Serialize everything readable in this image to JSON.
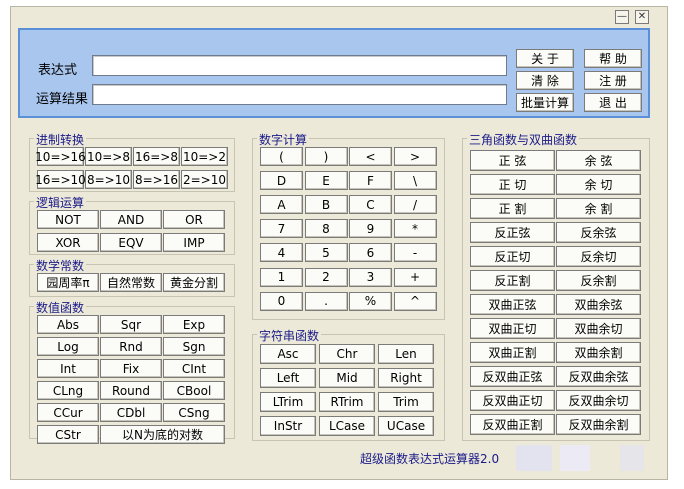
{
  "window": {
    "minimize_glyph": "—",
    "close_glyph": "✕"
  },
  "top": {
    "expression_label": "表达式",
    "result_label": "运算结果",
    "expression_value": "",
    "result_value": "",
    "buttons": [
      "关 于",
      "帮 助",
      "清 除",
      "注 册",
      "批量计算",
      "退 出"
    ]
  },
  "groups": {
    "base": {
      "title": "进制转换",
      "buttons": [
        "10=>16",
        "10=>8",
        "16=>8",
        "10=>2",
        "16=>10",
        "8=>10",
        "8=>16",
        "2=>10"
      ]
    },
    "logic": {
      "title": "逻辑运算",
      "buttons": [
        "NOT",
        "AND",
        "OR",
        "XOR",
        "EQV",
        "IMP"
      ]
    },
    "constants": {
      "title": "数学常数",
      "buttons": [
        "园周率π",
        "自然常数",
        "黄金分割"
      ]
    },
    "numeric": {
      "title": "数值函数",
      "buttons": [
        "Abs",
        "Sqr",
        "Exp",
        "Log",
        "Rnd",
        "Sgn",
        "Int",
        "Fix",
        "CInt",
        "CLng",
        "Round",
        "CBool",
        "CCur",
        "CDbl",
        "CSng",
        "CStr",
        "以N为底的对数"
      ]
    },
    "digits": {
      "title": "数字计算",
      "buttons": [
        "(",
        ")",
        "<",
        ">",
        "D",
        "E",
        "F",
        "\\",
        "A",
        "B",
        "C",
        "/",
        "7",
        "8",
        "9",
        "*",
        "4",
        "5",
        "6",
        "-",
        "1",
        "2",
        "3",
        "+",
        "0",
        ".",
        "%",
        "^"
      ]
    },
    "string": {
      "title": "字符串函数",
      "buttons": [
        "Asc",
        "Chr",
        "Len",
        "Left",
        "Mid",
        "Right",
        "LTrim",
        "RTrim",
        "Trim",
        "InStr",
        "LCase",
        "UCase"
      ]
    },
    "trig": {
      "title": "三角函数与双曲函数",
      "buttons": [
        "正 弦",
        "余 弦",
        "正 切",
        "余 切",
        "正 割",
        "余 割",
        "反正弦",
        "反余弦",
        "反正切",
        "反余切",
        "反正割",
        "反余割",
        "双曲正弦",
        "双曲余弦",
        "双曲正切",
        "双曲余切",
        "双曲正割",
        "双曲余割",
        "反双曲正弦",
        "反双曲余弦",
        "反双曲正切",
        "反双曲余切",
        "反双曲正割",
        "反双曲余割"
      ]
    }
  },
  "status_text": "超级函数表达式运算器2.0",
  "colors": {
    "panel": "#a9c6ee",
    "panel_border": "#5b8fd8",
    "window": "#ece9d8",
    "group_title": "#1a1a8a"
  }
}
